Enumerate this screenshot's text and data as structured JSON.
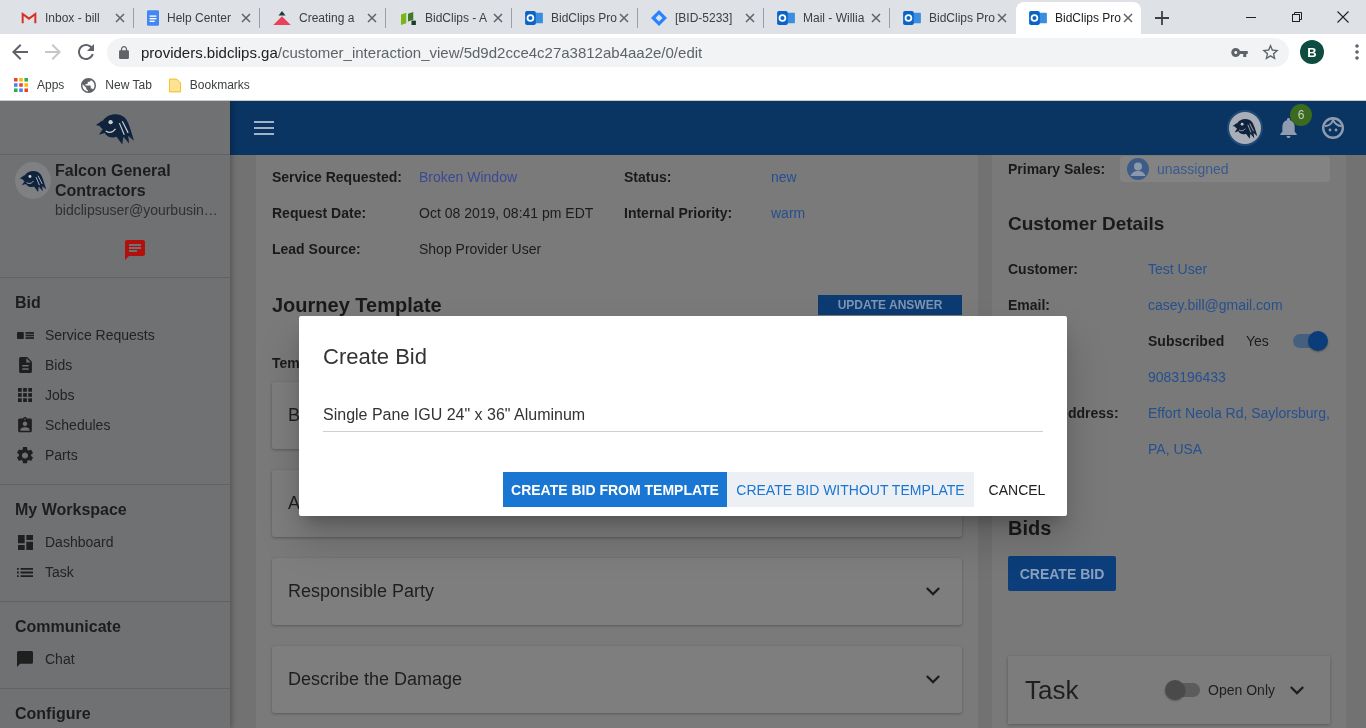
{
  "browser": {
    "tabs": [
      {
        "title": "Inbox - bill",
        "kind": "gmail",
        "selected": false
      },
      {
        "title": "Help Center",
        "kind": "docs",
        "selected": false
      },
      {
        "title": "Creating a",
        "kind": "triangle",
        "selected": false
      },
      {
        "title": "BidClips - A",
        "kind": "bidclips",
        "selected": false
      },
      {
        "title": "BidClips Pro",
        "kind": "outlook",
        "selected": false
      },
      {
        "title": "[BID-5233]",
        "kind": "jira",
        "selected": false
      },
      {
        "title": "Mail - Willia",
        "kind": "outlook",
        "selected": false
      },
      {
        "title": "BidClips Pro",
        "kind": "outlook",
        "selected": false
      },
      {
        "title": "BidClips Pro",
        "kind": "outlook",
        "selected": true
      }
    ],
    "nav": [
      {
        "kind": "back",
        "disabled": false
      },
      {
        "kind": "forward",
        "disabled": true
      },
      {
        "kind": "reload",
        "disabled": false
      }
    ],
    "url": {
      "host": "providers.bidclips.ga",
      "path": "/customer_interaction_view/5d9d2cce4c27a3812ab4aa2e/0/edit"
    },
    "profile_initial": "B",
    "bookmarks": [
      {
        "label": "Apps",
        "kind": "apps"
      },
      {
        "label": "New Tab",
        "kind": "globe"
      },
      {
        "label": "Bookmarks",
        "kind": "folder"
      }
    ]
  },
  "sidebar": {
    "company": "Falcon General Contractors",
    "email": "bidclipsuser@yourbusin…",
    "sections": [
      {
        "title": "Bid",
        "items": [
          {
            "label": "Service Requests",
            "kind": "requests"
          },
          {
            "label": "Bids",
            "kind": "document"
          },
          {
            "label": "Jobs",
            "kind": "grid"
          },
          {
            "label": "Schedules",
            "kind": "contact"
          },
          {
            "label": "Parts",
            "kind": "gear"
          }
        ]
      },
      {
        "title": "My Workspace",
        "items": [
          {
            "label": "Dashboard",
            "kind": "dashboard"
          },
          {
            "label": "Task",
            "kind": "list"
          }
        ]
      },
      {
        "title": "Communicate",
        "items": [
          {
            "label": "Chat",
            "kind": "chat"
          }
        ]
      },
      {
        "title": "Configure"
      }
    ]
  },
  "header": {
    "notification_count": "6"
  },
  "request": {
    "fields": [
      {
        "label": "Service Requested:",
        "value": "Broken Window",
        "kind": "link"
      },
      {
        "label": "Status:",
        "value": "new",
        "kind": "accent"
      },
      {
        "label": "Request Date:",
        "value": "Oct 08 2019, 08:41 pm EDT",
        "kind": "text"
      },
      {
        "label": "Internal Priority:",
        "value": "warm",
        "kind": "accent"
      },
      {
        "label": "Lead Source:",
        "value": "Shop Provider User",
        "kind": "text"
      }
    ]
  },
  "journey": {
    "title": "Journey Template",
    "button": "UPDATE ANSWER",
    "template_label": "Tem",
    "covered_sections": [
      {
        "title": "B"
      },
      {
        "title": "A"
      }
    ],
    "sections": [
      {
        "title": "Responsible Party",
        "expanded": false
      },
      {
        "title": "Describe the Damage",
        "expanded": false
      }
    ]
  },
  "customer": {
    "primary_sales": {
      "label": "Primary Sales:",
      "value": "unassigned"
    },
    "title": "Customer Details",
    "rows": [
      {
        "kind": "field",
        "label": "Customer:",
        "value": "Test User"
      },
      {
        "kind": "field",
        "label": "Email:",
        "value": "casey.bill@gmail.com"
      },
      {
        "kind": "subscription",
        "label": "Subscribed",
        "value": "Yes",
        "on": true
      },
      {
        "kind": "field",
        "value": "9083196433"
      },
      {
        "kind": "partial",
        "label": "ddress:",
        "value": "Effort Neola Rd, Saylorsburg, PA, USA"
      }
    ]
  },
  "bids": {
    "title": "Bids",
    "button": "CREATE BID"
  },
  "task": {
    "title": "Task",
    "filter_label": "Open Only",
    "filter_on": false
  },
  "dialog": {
    "title": "Create Bid",
    "value": "Single Pane IGU 24\" x 36\" Aluminum",
    "buttons": [
      {
        "label": "CREATE BID FROM TEMPLATE",
        "kind": "primary"
      },
      {
        "label": "CREATE BID WITHOUT TEMPLATE",
        "kind": "secondary"
      },
      {
        "label": "CANCEL",
        "kind": "text"
      }
    ]
  }
}
